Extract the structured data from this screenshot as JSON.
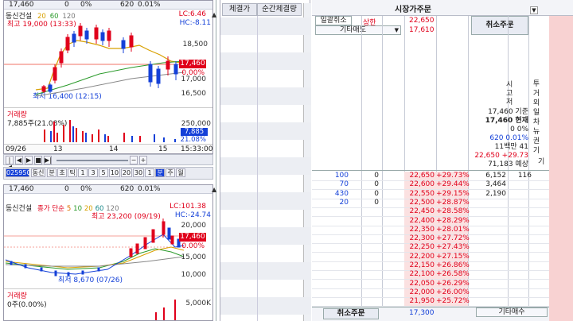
{
  "chart1": {
    "topbar": {
      "price": "17,460",
      "chg": "0",
      "pct": "0%",
      "vol": "620",
      "rate": "0.01%"
    },
    "title": "동신건설",
    "ma_labels": [
      "20",
      "60",
      "120"
    ],
    "lc": "LC:6.46",
    "hc": "HC:-8.11",
    "high_label": "최고 19,000 (13:33)",
    "low_label": "최저 16,400 (12:15)",
    "price_box": "17,460",
    "zero_box": "0.00%",
    "axis": [
      "18,500",
      "17,000",
      "16,500"
    ],
    "vol_title": "거래량",
    "vol_label": "7,885주(21.08%)",
    "vol_axis": "250,000",
    "vol_box": "7,885",
    "vol_pct": "21.08%",
    "x_labels": [
      "09/26",
      "13",
      "14",
      "15",
      "15:33:00"
    ]
  },
  "toolbar": {
    "code": "025950",
    "name": "동신",
    "items": [
      "분",
      "초",
      "틱",
      "1",
      "3",
      "5",
      "10",
      "20",
      "30",
      "1",
      "분",
      "주",
      "월"
    ]
  },
  "chart2": {
    "topbar": {
      "price": "17,460",
      "chg": "0",
      "pct": "0%",
      "vol": "620",
      "rate": "0.01%"
    },
    "title": "동신건설",
    "ma_labels": [
      "종가 단순",
      "5",
      "10",
      "20",
      "60",
      "120"
    ],
    "lc": "LC:101.38",
    "hc": "HC:-24.74",
    "high_label": "최고 23,200 (09/19)",
    "low_label": "최저 8,670 (07/26)",
    "price_box": "17,460",
    "zero_box": "0.00%",
    "axis": [
      "20,000",
      "15,000",
      "10,000"
    ],
    "vol_title": "거래량",
    "vol_label": "0주(0.00%)",
    "vol_axis": "5,000K"
  },
  "mid": {
    "col1": "체결가",
    "col2": "순간체결량"
  },
  "order": {
    "title": "시장가주문",
    "btn_cancel_all": "일괄취소",
    "upper_label": "상한",
    "upper_price": "22,650",
    "other_sell": "기타매도",
    "sell_price": "17,610",
    "cancel_order": "취소주문",
    "info_vertical": [
      "시",
      "고",
      "저"
    ],
    "info_side": [
      "투",
      "거",
      "외",
      "일",
      "차",
      "뉴",
      "권",
      "기"
    ],
    "info": {
      "base_line": "17,460 기준",
      "current_line": "17,460 현재",
      "zero_line": "0 0%",
      "vol_line": "620 0.01%",
      "amount_line": "11백만 41",
      "upper_line": "22,650 +29.73",
      "expect_line": "71,183 예상"
    },
    "bid_rows": [
      {
        "qty": "100",
        "n": "0",
        "price": "22,650",
        "chg": "+29.73%",
        "right": "6,152",
        "right2": "116"
      },
      {
        "qty": "70",
        "n": "0",
        "price": "22,600",
        "chg": "+29.44%",
        "right": "3,464",
        "right2": ""
      },
      {
        "qty": "430",
        "n": "0",
        "price": "22,550",
        "chg": "+29.15%",
        "right": "2,190",
        "right2": ""
      },
      {
        "qty": "20",
        "n": "0",
        "price": "22,500",
        "chg": "+28.87%",
        "right": "",
        "right2": ""
      },
      {
        "qty": "",
        "n": "",
        "price": "22,450",
        "chg": "+28.58%",
        "right": "",
        "right2": ""
      },
      {
        "qty": "",
        "n": "",
        "price": "22,400",
        "chg": "+28.29%",
        "right": "",
        "right2": ""
      },
      {
        "qty": "",
        "n": "",
        "price": "22,350",
        "chg": "+28.01%",
        "right": "",
        "right2": ""
      },
      {
        "qty": "",
        "n": "",
        "price": "22,300",
        "chg": "+27.72%",
        "right": "",
        "right2": ""
      },
      {
        "qty": "",
        "n": "",
        "price": "22,250",
        "chg": "+27.43%",
        "right": "",
        "right2": ""
      },
      {
        "qty": "",
        "n": "",
        "price": "22,200",
        "chg": "+27.15%",
        "right": "",
        "right2": ""
      },
      {
        "qty": "",
        "n": "",
        "price": "22,150",
        "chg": "+26.86%",
        "right": "",
        "right2": ""
      },
      {
        "qty": "",
        "n": "",
        "price": "22,100",
        "chg": "+26.58%",
        "right": "",
        "right2": ""
      },
      {
        "qty": "",
        "n": "",
        "price": "22,050",
        "chg": "+26.29%",
        "right": "",
        "right2": ""
      },
      {
        "qty": "",
        "n": "",
        "price": "22,000",
        "chg": "+26.00%",
        "right": "",
        "right2": ""
      },
      {
        "qty": "",
        "n": "",
        "price": "21,950",
        "chg": "+25.72%",
        "right": "",
        "right2": ""
      }
    ],
    "bottom_cancel": "취소주문",
    "bottom_price": "17,300",
    "bottom_other": "기타매수"
  }
}
